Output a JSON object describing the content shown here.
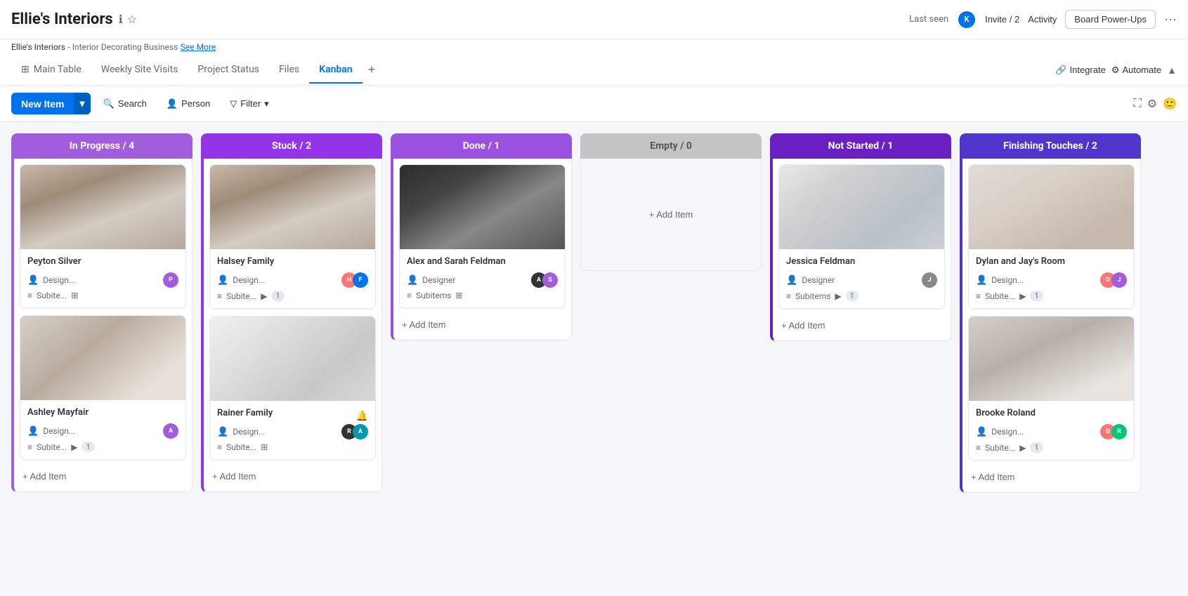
{
  "app": {
    "title": "Ellie's Interiors",
    "breadcrumb_main": "Ellie's Interiors",
    "breadcrumb_sub": "Interior Decorating Business",
    "see_more": "See More"
  },
  "header": {
    "last_seen_label": "Last seen",
    "invite_label": "Invite / 2",
    "activity_label": "Activity",
    "board_power_ups_label": "Board Power-Ups"
  },
  "tabs": [
    {
      "id": "main-table",
      "label": "Main Table",
      "icon": "⊞",
      "active": false
    },
    {
      "id": "weekly-site-visits",
      "label": "Weekly Site Visits",
      "icon": "",
      "active": false
    },
    {
      "id": "project-status",
      "label": "Project Status",
      "icon": "",
      "active": false
    },
    {
      "id": "files",
      "label": "Files",
      "icon": "",
      "active": false
    },
    {
      "id": "kanban",
      "label": "Kanban",
      "icon": "",
      "active": true
    }
  ],
  "tabs_right": {
    "integrate": "Integrate",
    "automate": "Automate"
  },
  "toolbar": {
    "new_item": "New Item",
    "search": "Search",
    "person": "Person",
    "filter": "Filter"
  },
  "columns": [
    {
      "id": "in-progress",
      "title": "In Progress / 4",
      "color_class": "in-progress",
      "accent_class": "left-accent",
      "cards": [
        {
          "id": "card-peyton",
          "title": "Peyton Silver",
          "img_class": "img-kitchen1",
          "design_label": "Design...",
          "has_avatar": true,
          "avatar_color": "av-purple",
          "avatar_initial": "P",
          "subitems_label": "Subite...",
          "has_subitem_count": false,
          "subitem_count": ""
        },
        {
          "id": "card-ashley",
          "title": "Ashley Mayfair",
          "img_class": "img-living1",
          "design_label": "Design...",
          "has_avatar": true,
          "avatar_color": "av-purple",
          "avatar_initial": "A",
          "subitems_label": "Subite...",
          "has_subitem_count": true,
          "subitem_count": "1"
        }
      ],
      "add_item_label": "+ Add Item",
      "show_add": true
    },
    {
      "id": "stuck",
      "title": "Stuck / 2",
      "color_class": "stuck",
      "accent_class": "left-accent-stuck",
      "cards": [
        {
          "id": "card-halsey",
          "title": "Halsey Family",
          "img_class": "img-kitchen2",
          "design_label": "Design...",
          "has_avatar": true,
          "avatar_color": "av-pair",
          "avatar_initial": "H",
          "subitems_label": "Subite...",
          "has_subitem_count": true,
          "subitem_count": "1"
        },
        {
          "id": "card-rainer",
          "title": "Rainer Family",
          "img_class": "img-living2",
          "design_label": "Design...",
          "has_avatar": true,
          "avatar_color": "av-pair2",
          "avatar_initial": "R",
          "subitems_label": "Subite...",
          "has_subitem_count": false,
          "subitem_count": ""
        }
      ],
      "add_item_label": "+ Add Item",
      "show_add": true
    },
    {
      "id": "done",
      "title": "Done / 1",
      "color_class": "done",
      "accent_class": "left-accent-done",
      "cards": [
        {
          "id": "card-alex",
          "title": "Alex and Sarah Feldman",
          "img_class": "img-bath1",
          "design_label": "Designer",
          "has_avatar": true,
          "avatar_color": "av-pair3",
          "avatar_initial": "A",
          "subitems_label": "Subitems",
          "has_subitem_count": false,
          "subitem_count": ""
        }
      ],
      "add_item_label": "+ Add Item",
      "show_add": true
    },
    {
      "id": "empty-col",
      "title": "Empty / 0",
      "color_class": "empty",
      "is_empty": true,
      "empty_label": "Empty",
      "add_item_label": "+ Add Item",
      "show_add": true
    },
    {
      "id": "not-started",
      "title": "Not Started / 1",
      "color_class": "not-started",
      "accent_class": "left-accent-not-started",
      "cards": [
        {
          "id": "card-jessica",
          "title": "Jessica Feldman",
          "img_class": "img-bedroom1",
          "design_label": "Designer",
          "has_avatar": true,
          "avatar_color": "av-gray",
          "avatar_initial": "J",
          "subitems_label": "Subitems",
          "has_subitem_count": true,
          "subitem_count": "1"
        }
      ],
      "add_item_label": "+ Add Item",
      "show_add": true
    },
    {
      "id": "finishing-touches",
      "title": "Finishing Touches / 2",
      "color_class": "finishing-touches",
      "accent_class": "left-accent-finishing",
      "cards": [
        {
          "id": "card-dylan",
          "title": "Dylan and Jay's Room",
          "img_class": "img-bedroom2",
          "design_label": "Design...",
          "has_avatar": true,
          "avatar_color": "av-pair4",
          "avatar_initial": "D",
          "subitems_label": "Subite...",
          "has_subitem_count": true,
          "subitem_count": "1"
        },
        {
          "id": "card-brooke",
          "title": "Brooke Roland",
          "img_class": "img-kitchen3",
          "design_label": "Design...",
          "has_avatar": true,
          "avatar_color": "av-pair5",
          "avatar_initial": "B",
          "subitems_label": "Subite...",
          "has_subitem_count": true,
          "subitem_count": "1"
        }
      ],
      "add_item_label": "+ Add Item",
      "show_add": true
    }
  ]
}
